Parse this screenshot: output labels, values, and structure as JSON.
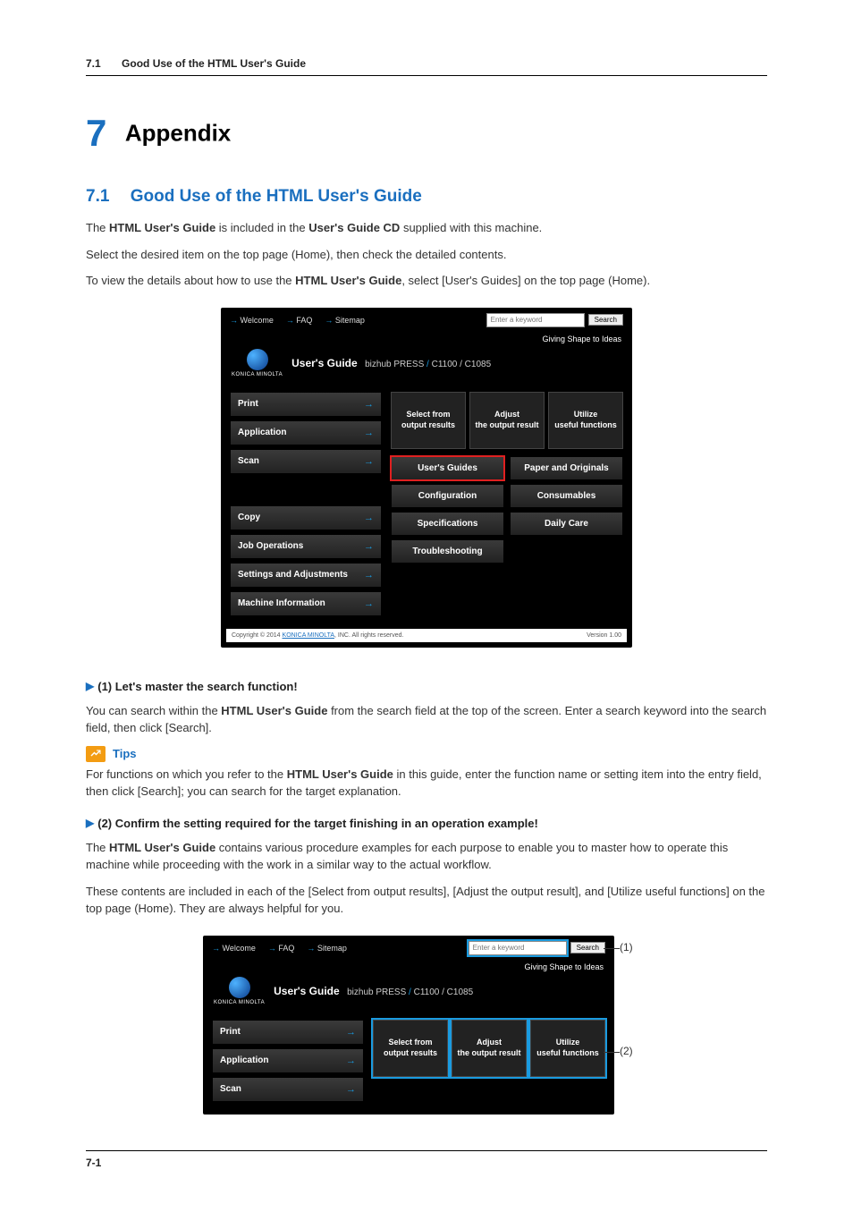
{
  "header": {
    "section_num": "7.1",
    "section_title": "Good Use of the HTML User's Guide"
  },
  "chapter": {
    "num": "7",
    "title": "Appendix"
  },
  "section": {
    "num": "7.1",
    "title": "Good Use of the HTML User's Guide",
    "p1_pre": "The ",
    "p1_b1": "HTML User's Guide",
    "p1_mid": " is included in the ",
    "p1_b2": "User's Guide CD",
    "p1_post": " supplied with this machine.",
    "p2": "Select the desired item on the top page (Home), then check the detailed contents.",
    "p3_pre": "To view the details about how to use the ",
    "p3_b": "HTML User's Guide",
    "p3_post": ", select [User's Guides] on the top page (Home)."
  },
  "shot": {
    "top_links": {
      "welcome": "Welcome",
      "faq": "FAQ",
      "sitemap": "Sitemap"
    },
    "search": {
      "placeholder": "Enter a keyword",
      "button": "Search"
    },
    "tagline": "Giving Shape to Ideas",
    "logo_text": "KONICA MINOLTA",
    "title": "User's Guide",
    "subtitle_prefix": "bizhub PRESS",
    "subtitle_model": " C1100 / C1085",
    "side": {
      "print": "Print",
      "application": "Application",
      "scan": "Scan",
      "copy": "Copy",
      "job_ops": "Job Operations",
      "settings": "Settings and Adjustments",
      "machine_info": "Machine Information"
    },
    "tri": {
      "a": "Select from\noutput results",
      "b": "Adjust\nthe output result",
      "c": "Utilize\nuseful functions"
    },
    "grid": {
      "users_guides": "User's Guides",
      "paper": "Paper and Originals",
      "config": "Configuration",
      "consumables": "Consumables",
      "specs": "Specifications",
      "daily": "Daily Care",
      "trouble": "Troubleshooting"
    },
    "footer": {
      "copyright_pre": "Copyright © 2014 ",
      "copyright_link": "KONICA MINOLTA",
      "copyright_post": ", INC. All rights reserved.",
      "version": "Version 1.00"
    }
  },
  "sub1": {
    "heading": "(1) Let's master the search function!",
    "p_pre": "You can search within the ",
    "p_b": "HTML User's Guide",
    "p_post": " from the search field at the top of the screen. Enter a search keyword into the search field, then click [Search]."
  },
  "tips": {
    "label": "Tips",
    "p_pre": "For functions on which you refer to the ",
    "p_b": "HTML User's Guide",
    "p_post": " in this guide, enter the function name or setting item into the entry field, then click [Search]; you can search for the target explanation."
  },
  "sub2": {
    "heading": "(2) Confirm the setting required for the target finishing in an operation example!",
    "p1_pre": "The ",
    "p1_b": "HTML User's Guide",
    "p1_post": " contains various procedure examples for each purpose to enable you to master how to operate this machine while proceeding with the work in a similar way to the actual workflow.",
    "p2": "These contents are included in each of the [Select from output results], [Adjust the output result], and [Utilize useful functions] on the top page (Home). They are always helpful for you."
  },
  "callouts": {
    "c1": "(1)",
    "c2": "(2)"
  },
  "page_footer": "7-1"
}
